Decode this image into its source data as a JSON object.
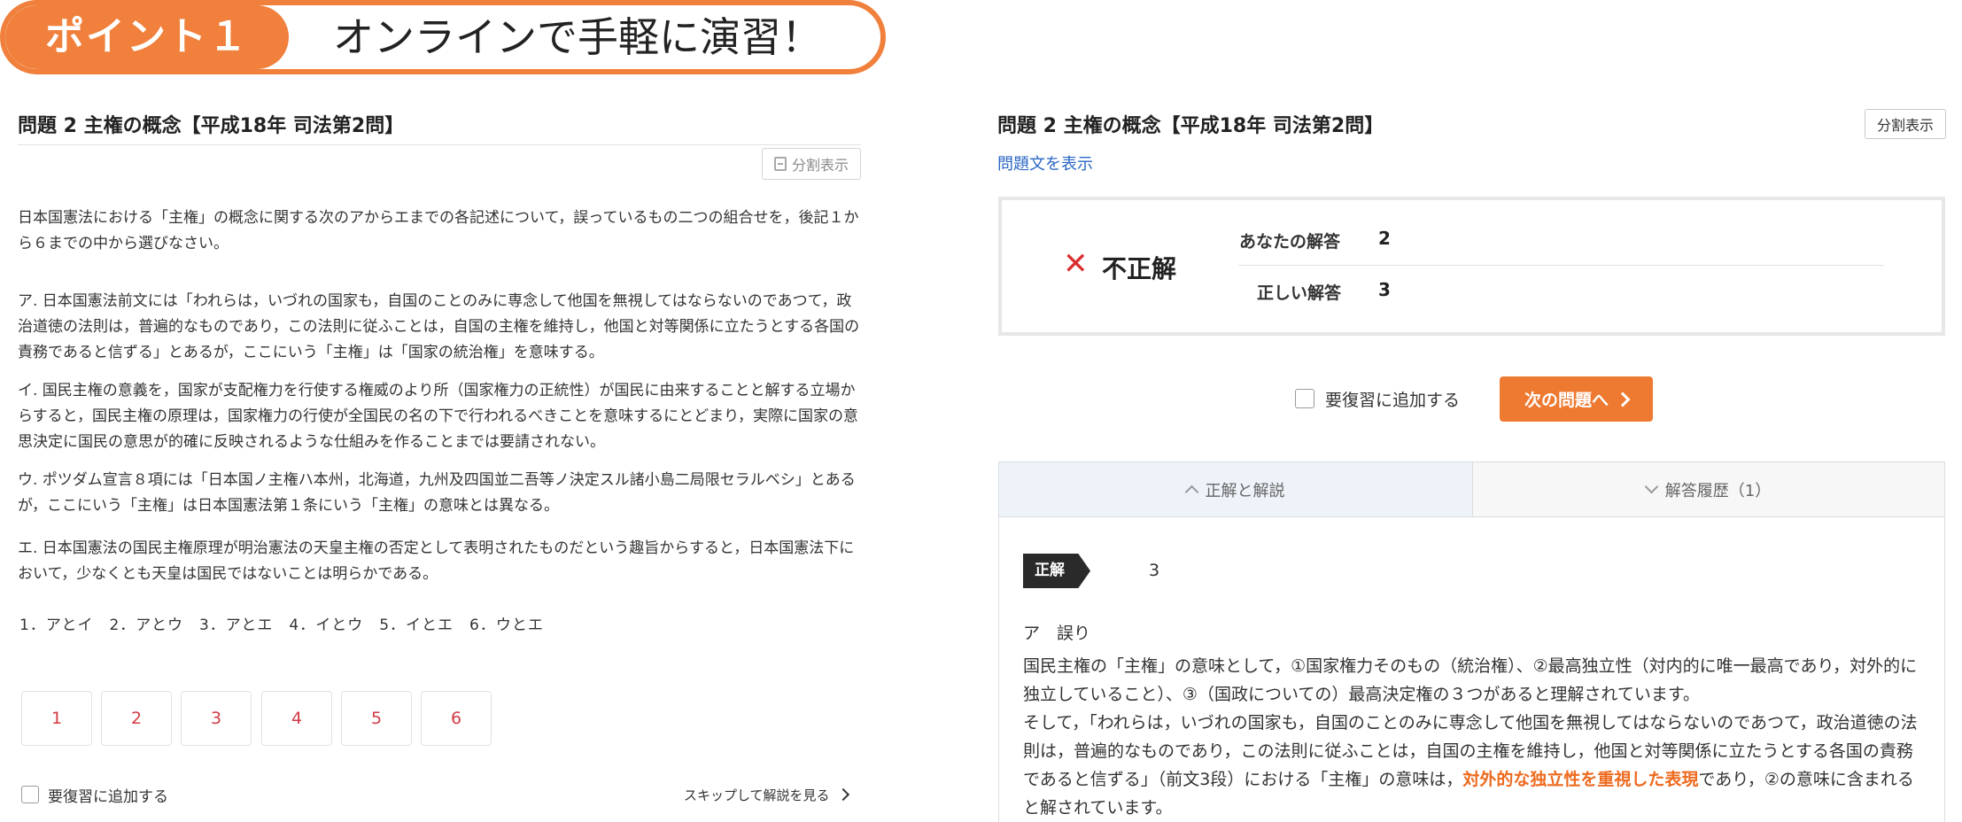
{
  "banner": {
    "tag": "ポイント１",
    "title": "オンラインで手軽に演習！"
  },
  "left": {
    "title": "問題 2 主権の概念【平成18年 司法第2問】",
    "split_label": "分割表示",
    "prompt": "日本国憲法における「主権」の概念に関する次のアからエまでの各記述について，誤っているもの二つの組合せを，後記１から６までの中から選びなさい。",
    "statements": [
      "ア. 日本国憲法前文には「われらは，いづれの国家も，自国のことのみに専念して他国を無視してはならないのであつて，政治道徳の法則は，普遍的なものであり，この法則に従ふことは，自国の主権を維持し，他国と対等関係に立たうとする各国の責務であると信ずる」とあるが，ここにいう「主権」は「国家の統治権」を意味する。",
      "イ. 国民主権の意義を，国家が支配権力を行使する権威のより所（国家権力の正統性）が国民に由来することと解する立場からすると，国民主権の原理は，国家権力の行使が全国民の名の下で行われるべきことを意味するにとどまり，実際に国家の意思決定に国民の意思が的確に反映されるような仕組みを作ることまでは要請されない。",
      "ウ. ポツダム宣言８項には「日本国ノ主権ハ本州，北海道，九州及四国並二吾等ノ決定スル諸小島二局限セラルベシ」とあるが，ここにいう「主権」は日本国憲法第１条にいう「主権」の意味とは異なる。",
      "エ. 日本国憲法の国民主権原理が明治憲法の天皇主権の否定として表明されたものだという趣旨からすると，日本国憲法下において，少なくとも天皇は国民ではないことは明らかである。"
    ],
    "choices": "1．アとイ　2．アとウ　3．アとエ　4．イとウ　5．イとエ　6．ウとエ",
    "answer_buttons": [
      "1",
      "2",
      "3",
      "4",
      "5",
      "6"
    ],
    "review_label": "要復習に追加する",
    "skip_label": "スキップして解説を見る"
  },
  "right": {
    "title": "問題 2 主権の概念【平成18年 司法第2問】",
    "split_label": "分割表示",
    "show_question_link": "問題文を表示",
    "result": {
      "status": "不正解",
      "your_answer_label": "あなたの解答",
      "your_answer": "2",
      "correct_label": "正しい解答",
      "correct_answer": "3"
    },
    "review_label": "要復習に追加する",
    "next_label": "次の問題へ",
    "tabs": {
      "explanation": "正解と解説",
      "history": "解答履歴（1）"
    },
    "badge": "正解",
    "correct_value": "3",
    "verdict": "ア　誤り",
    "expl_line1": "国民主権の「主権」の意味として，①国家権力そのもの（統治権）、②最高独立性（対内的に唯一最高であり，対外的に独立していること）、③（国政についての）最高決定権の３つがあると理解されています。",
    "expl_line2a": "そして，「われらは，いづれの国家も，自国のことのみに専念して他国を無視してはならないのであつて，政治道徳の法則は，普遍的なものであり，この法則に従ふことは，自国の主権を維持し，他国と対等関係に立たうとする各国の責務であると信ずる」（前文3段）における「主権」の意味は，",
    "expl_highlight": "対外的な独立性を重視した表現",
    "expl_line2b": "であり，②の意味に含まれると解されています。"
  },
  "colors": {
    "accent": "#f0803c",
    "button": "#ee7a32",
    "wrong": "#d9302e",
    "link": "#2a67c5",
    "answer_text": "#d23b45"
  }
}
